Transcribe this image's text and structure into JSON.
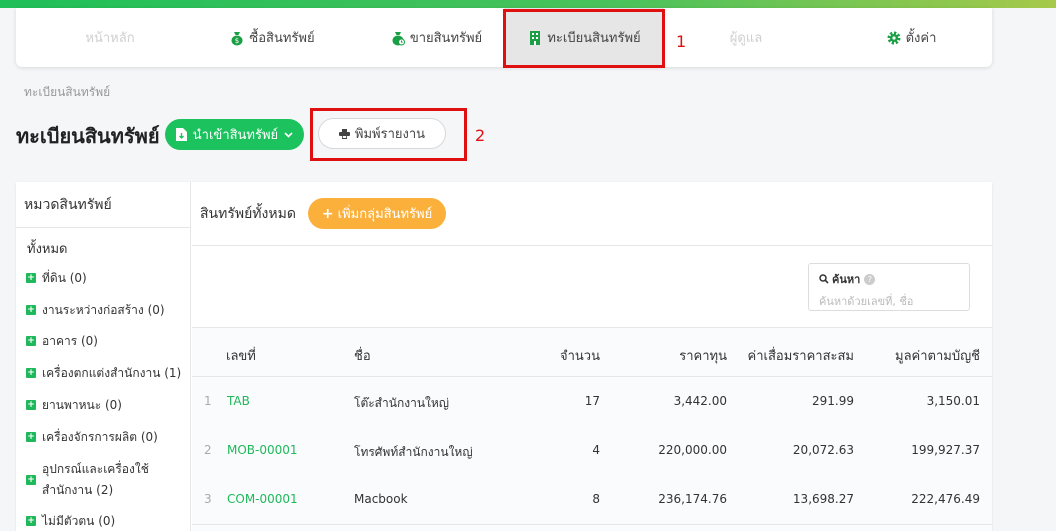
{
  "nav": [
    {
      "label": "หน้าหลัก",
      "icon": "",
      "state": "disabled"
    },
    {
      "label": "ซื้อสินทรัพย์",
      "icon": "money-bag-icon",
      "state": "normal"
    },
    {
      "label": "ขายสินทรัพย์",
      "icon": "money-bag-clock-icon",
      "state": "normal"
    },
    {
      "label": "ทะเบียนสินทรัพย์",
      "icon": "building-icon",
      "state": "active"
    },
    {
      "label": "ผู้ดูแล",
      "icon": "",
      "state": "disabled"
    },
    {
      "label": "ตั้งค่า",
      "icon": "gear-icon",
      "state": "normal"
    }
  ],
  "annotations": [
    "1",
    "2"
  ],
  "breadcrumb": "ทะเบียนสินทรัพย์",
  "page_title": "ทะเบียนสินทรัพย์",
  "buttons": {
    "import_label": "นำเข้าสินทรัพย์",
    "print_label": "พิมพ์รายงาน",
    "add_group_label": "เพิ่มกลุ่มสินทรัพย์"
  },
  "sidebar": {
    "title": "หมวดสินทรัพย์",
    "all_label": "ทั้งหมด",
    "items": [
      {
        "label": "ที่ดิน (0)"
      },
      {
        "label": "งานระหว่างก่อสร้าง (0)"
      },
      {
        "label": "อาคาร (0)"
      },
      {
        "label": "เครื่องตกแต่งสำนักงาน (1)"
      },
      {
        "label": "ยานพาหนะ (0)"
      },
      {
        "label": "เครื่องจักรการผลิต (0)"
      },
      {
        "label": "อุปกรณ์และเครื่องใช้สำนักงาน (2)"
      },
      {
        "label": "ไม่มีตัวตน (0)"
      }
    ]
  },
  "main": {
    "title": "สินทรัพย์ทั้งหมด",
    "search_label": "ค้นหา",
    "search_placeholder": "ค้นหาด้วยเลขที่, ชื่อ"
  },
  "table": {
    "headers": [
      "เลขที่",
      "ชื่อ",
      "จำนวน",
      "ราคาทุน",
      "ค่าเสื่อมราคาสะสม",
      "มูลค่าตามบัญชี"
    ],
    "rows": [
      {
        "no": "1",
        "code": "TAB",
        "name": "โต๊ะสำนักงานใหญ่",
        "qty": "17",
        "cost": "3,442.00",
        "dep": "291.99",
        "book": "3,150.01"
      },
      {
        "no": "2",
        "code": "MOB-00001",
        "name": "โทรศัพท์สำนักงานใหญ่",
        "qty": "4",
        "cost": "220,000.00",
        "dep": "20,072.63",
        "book": "199,927.37"
      },
      {
        "no": "3",
        "code": "COM-00001",
        "name": "Macbook",
        "qty": "8",
        "cost": "236,174.76",
        "dep": "13,698.27",
        "book": "222,476.49"
      }
    ]
  },
  "colors": {
    "accent_green": "#1cc25e",
    "accent_orange": "#fbb03b",
    "annotation_red": "#e01010"
  }
}
